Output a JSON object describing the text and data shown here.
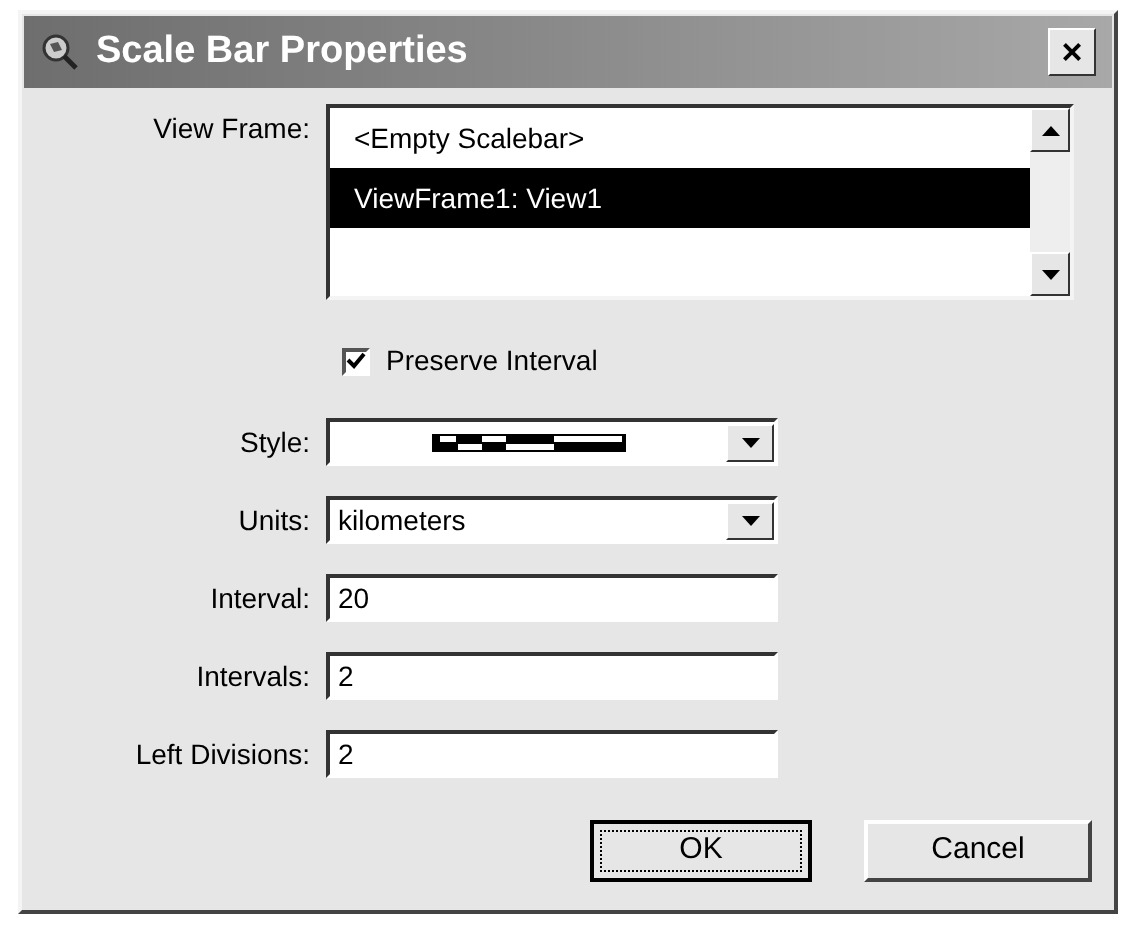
{
  "window": {
    "title": "Scale Bar Properties",
    "close": "×"
  },
  "view_frame": {
    "label": "View Frame:",
    "items": [
      {
        "text": "<Empty Scalebar>",
        "selected": false
      },
      {
        "text": "ViewFrame1: View1",
        "selected": true
      }
    ]
  },
  "preserve_interval": {
    "label": "Preserve Interval",
    "checked": true
  },
  "fields": [
    {
      "kind": "style",
      "label": "Style:"
    },
    {
      "kind": "select",
      "label": "Units:",
      "value": "kilometers"
    },
    {
      "kind": "text",
      "label": "Interval:",
      "value": "20"
    },
    {
      "kind": "text",
      "label": "Intervals:",
      "value": "2"
    },
    {
      "kind": "text",
      "label": "Left Divisions:",
      "value": "2"
    }
  ],
  "buttons": [
    {
      "label": "OK",
      "default": true
    },
    {
      "label": "Cancel",
      "default": false
    }
  ]
}
